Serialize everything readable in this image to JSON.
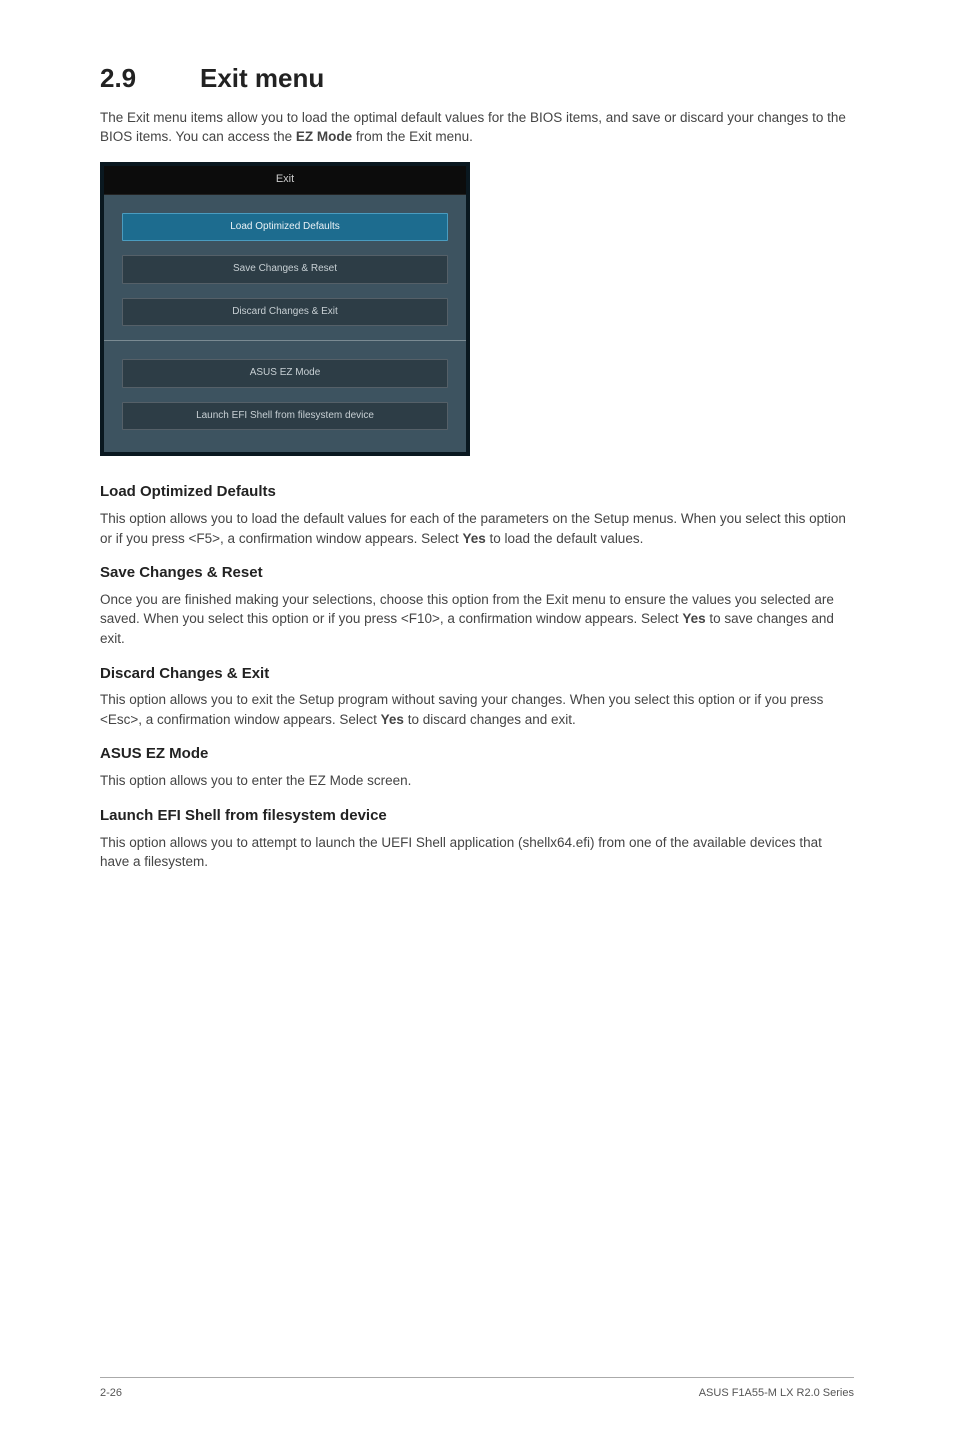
{
  "section": {
    "number": "2.9",
    "title": "Exit menu"
  },
  "intro": {
    "prefix": "The Exit menu items allow you to load the optimal default values for the BIOS items, and save or discard your changes to the BIOS items. You can access the ",
    "bold": "EZ Mode",
    "suffix": " from the Exit menu."
  },
  "bios": {
    "header": "Exit",
    "btn_load": "Load Optimized Defaults",
    "btn_save": "Save Changes & Reset",
    "btn_discard": "Discard Changes & Exit",
    "btn_ez": "ASUS EZ Mode",
    "btn_launch": "Launch EFI Shell from filesystem device"
  },
  "items": {
    "load": {
      "heading": "Load Optimized Defaults",
      "p_pre": "This option allows you to load the default values for each of the parameters on the Setup menus. When you select this option or if you press <F5>, a confirmation window appears. Select ",
      "p_bold": "Yes",
      "p_post": " to load the default values."
    },
    "save": {
      "heading": "Save Changes & Reset",
      "p_pre": "Once you are finished making your selections, choose this option from the Exit menu to ensure the values you selected are saved. When you select this option or if you press <F10>, a confirmation window appears. Select ",
      "p_bold": "Yes",
      "p_post": " to save changes and exit."
    },
    "discard": {
      "heading": "Discard Changes & Exit",
      "p_pre": "This option allows you to exit the Setup program without saving your changes. When you select this option or if you press <Esc>, a confirmation window appears. Select ",
      "p_bold": "Yes",
      "p_post": " to discard changes and exit."
    },
    "ez": {
      "heading": "ASUS EZ Mode",
      "p": "This option allows you to enter the EZ Mode screen."
    },
    "launch": {
      "heading": "Launch EFI Shell from filesystem device",
      "p": "This option allows you to attempt to launch the UEFI Shell application (shellx64.efi) from one of the available devices that have a filesystem."
    }
  },
  "footer": {
    "page": "2-26",
    "product": "ASUS F1A55-M LX R2.0 Series"
  }
}
